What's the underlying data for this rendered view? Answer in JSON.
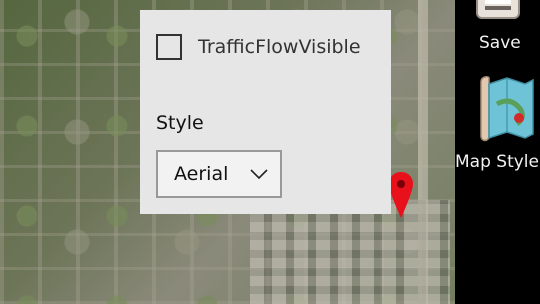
{
  "popup": {
    "checkbox_label": "TrafficFlowVisible",
    "checkbox_checked": false,
    "style_label": "Style",
    "style_value": "Aerial"
  },
  "toolbar": {
    "save_label": "Save",
    "map_style_label": "Map Style"
  },
  "colors": {
    "popup_bg": "#e6e6e6",
    "toolbar_bg": "#000000",
    "pin": "#e8101a"
  },
  "icons": {
    "save": "save-icon",
    "map_style": "map-style-icon",
    "pin": "map-pin-icon",
    "chevron": "chevron-down-icon"
  }
}
